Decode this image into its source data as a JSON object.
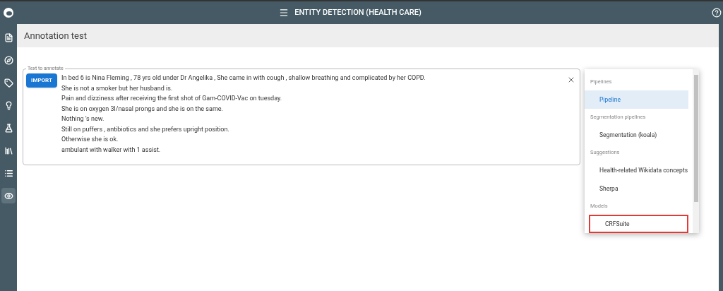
{
  "top_bar": {
    "title": "ENTITY DETECTION (HEALTH CARE)"
  },
  "sidebar": {
    "items": [
      {
        "kind": "document",
        "selected": false
      },
      {
        "kind": "compass",
        "selected": false
      },
      {
        "kind": "tag",
        "selected": false
      },
      {
        "kind": "bulb",
        "selected": false
      },
      {
        "kind": "flask",
        "selected": false
      },
      {
        "kind": "library",
        "selected": false
      },
      {
        "kind": "list",
        "selected": false
      },
      {
        "kind": "eye",
        "selected": true
      }
    ]
  },
  "page_title": "Annotation test",
  "annotate_field": {
    "label": "Text to annotate",
    "import_button": "IMPORT",
    "lines": [
      "In bed 6 is Nina Fleming , 78 yrs old under Dr Angelika , She came in with cough , shallow breathing and complicated by her COPD.",
      "She is not a smoker but her husband is.",
      "Pain and dizziness after receiving the first shot of Gam-COVID-Vac on tuesday.",
      "She is on oxygen 3l/nasal prongs and she is on the same.",
      "Nothing 's new.",
      "Still on puffers , antibiotics and she prefers upright position.",
      "Otherwise she is ok.",
      "ambulant with walker with 1 assist."
    ]
  },
  "menu": {
    "groups": [
      {
        "header": "Pipelines",
        "items": [
          {
            "label": "Pipeline",
            "selected": true,
            "outlined": false
          }
        ]
      },
      {
        "header": "Segmentation pipelines",
        "items": [
          {
            "label": "Segmentation (koala)",
            "selected": false,
            "outlined": false
          }
        ]
      },
      {
        "header": "Suggestions",
        "items": [
          {
            "label": "Health-related Wikidata concepts",
            "selected": false,
            "outlined": false
          },
          {
            "label": "Sherpa",
            "selected": false,
            "outlined": false
          }
        ]
      },
      {
        "header": "Models",
        "items": [
          {
            "label": "CRFSuite",
            "selected": false,
            "outlined": true
          }
        ]
      }
    ]
  }
}
